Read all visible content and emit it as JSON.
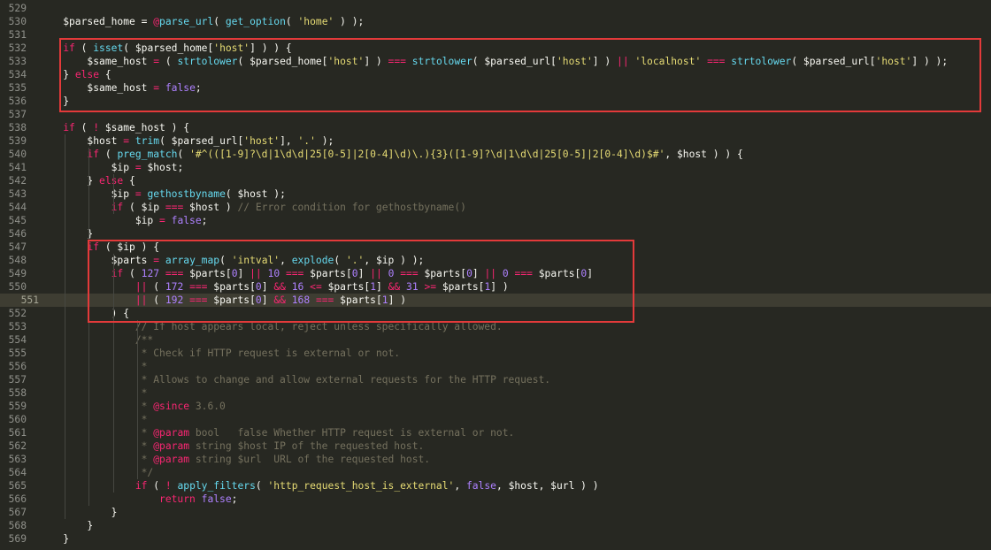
{
  "editor": {
    "theme": {
      "background": "#272822",
      "highlight_box": "#e33a3a",
      "keyword": "#f92672",
      "function": "#66d9ef",
      "string": "#e6db74",
      "number": "#ae81ff",
      "comment": "#75715e"
    },
    "active_line": 551,
    "lines": [
      {
        "n": "529",
        "t": [],
        "active": false
      },
      {
        "n": "530",
        "t": [
          [
            "v",
            "    $parsed_home = "
          ],
          [
            "k",
            "@"
          ],
          [
            "f",
            "parse_url"
          ],
          [
            "v",
            "( "
          ],
          [
            "f",
            "get_option"
          ],
          [
            "v",
            "( "
          ],
          [
            "s",
            "'home'"
          ],
          [
            "v",
            " ) );"
          ]
        ]
      },
      {
        "n": "531",
        "t": []
      },
      {
        "n": "532",
        "t": [
          [
            "v",
            "    "
          ],
          [
            "k",
            "if"
          ],
          [
            "v",
            " ( "
          ],
          [
            "f",
            "isset"
          ],
          [
            "v",
            "( $parsed_home["
          ],
          [
            "s",
            "'host'"
          ],
          [
            "v",
            "] ) ) {"
          ]
        ]
      },
      {
        "n": "533",
        "t": [
          [
            "v",
            "        $same_host "
          ],
          [
            "k",
            "="
          ],
          [
            "v",
            " ( "
          ],
          [
            "f",
            "strtolower"
          ],
          [
            "v",
            "( $parsed_home["
          ],
          [
            "s",
            "'host'"
          ],
          [
            "v",
            "] ) "
          ],
          [
            "k",
            "==="
          ],
          [
            "v",
            " "
          ],
          [
            "f",
            "strtolower"
          ],
          [
            "v",
            "( $parsed_url["
          ],
          [
            "s",
            "'host'"
          ],
          [
            "v",
            "] ) "
          ],
          [
            "k",
            "||"
          ],
          [
            "v",
            " "
          ],
          [
            "s",
            "'localhost'"
          ],
          [
            "v",
            " "
          ],
          [
            "k",
            "==="
          ],
          [
            "v",
            " "
          ],
          [
            "f",
            "strtolower"
          ],
          [
            "v",
            "( $parsed_url["
          ],
          [
            "s",
            "'host'"
          ],
          [
            "v",
            "] ) );"
          ]
        ]
      },
      {
        "n": "534",
        "t": [
          [
            "v",
            "    } "
          ],
          [
            "k",
            "else"
          ],
          [
            "v",
            " {"
          ]
        ]
      },
      {
        "n": "535",
        "t": [
          [
            "v",
            "        $same_host "
          ],
          [
            "k",
            "="
          ],
          [
            "v",
            " "
          ],
          [
            "n",
            "false"
          ],
          [
            "v",
            ";"
          ]
        ]
      },
      {
        "n": "536",
        "t": [
          [
            "v",
            "    }"
          ]
        ]
      },
      {
        "n": "537",
        "t": []
      },
      {
        "n": "538",
        "t": [
          [
            "v",
            "    "
          ],
          [
            "k",
            "if"
          ],
          [
            "v",
            " ( "
          ],
          [
            "k",
            "!"
          ],
          [
            "v",
            " $same_host ) {"
          ]
        ]
      },
      {
        "n": "539",
        "t": [
          [
            "v",
            "        $host "
          ],
          [
            "k",
            "="
          ],
          [
            "v",
            " "
          ],
          [
            "f",
            "trim"
          ],
          [
            "v",
            "( $parsed_url["
          ],
          [
            "s",
            "'host'"
          ],
          [
            "v",
            "], "
          ],
          [
            "s",
            "'.'"
          ],
          [
            "v",
            " );"
          ]
        ]
      },
      {
        "n": "540",
        "t": [
          [
            "v",
            "        "
          ],
          [
            "k",
            "if"
          ],
          [
            "v",
            " ( "
          ],
          [
            "f",
            "preg_match"
          ],
          [
            "v",
            "( "
          ],
          [
            "s",
            "'#^(([1-9]?\\d|1\\d\\d|25[0-5]|2[0-4]\\d)\\.){3}([1-9]?\\d|1\\d\\d|25[0-5]|2[0-4]\\d)$#'"
          ],
          [
            "v",
            ", $host ) ) {"
          ]
        ]
      },
      {
        "n": "541",
        "t": [
          [
            "v",
            "            $ip "
          ],
          [
            "k",
            "="
          ],
          [
            "v",
            " $host;"
          ]
        ]
      },
      {
        "n": "542",
        "t": [
          [
            "v",
            "        } "
          ],
          [
            "k",
            "else"
          ],
          [
            "v",
            " {"
          ]
        ]
      },
      {
        "n": "543",
        "t": [
          [
            "v",
            "            $ip "
          ],
          [
            "k",
            "="
          ],
          [
            "v",
            " "
          ],
          [
            "f",
            "gethostbyname"
          ],
          [
            "v",
            "( $host );"
          ]
        ]
      },
      {
        "n": "544",
        "t": [
          [
            "v",
            "            "
          ],
          [
            "k",
            "if"
          ],
          [
            "v",
            " ( $ip "
          ],
          [
            "k",
            "==="
          ],
          [
            "v",
            " $host ) "
          ],
          [
            "c",
            "// Error condition for gethostbyname()"
          ]
        ]
      },
      {
        "n": "545",
        "t": [
          [
            "v",
            "                $ip "
          ],
          [
            "k",
            "="
          ],
          [
            "v",
            " "
          ],
          [
            "n",
            "false"
          ],
          [
            "v",
            ";"
          ]
        ]
      },
      {
        "n": "546",
        "t": [
          [
            "v",
            "        }"
          ]
        ]
      },
      {
        "n": "547",
        "t": [
          [
            "v",
            "        "
          ],
          [
            "k",
            "if"
          ],
          [
            "v",
            " ( $ip ) {"
          ]
        ]
      },
      {
        "n": "548",
        "t": [
          [
            "v",
            "            $parts "
          ],
          [
            "k",
            "="
          ],
          [
            "v",
            " "
          ],
          [
            "f",
            "array_map"
          ],
          [
            "v",
            "( "
          ],
          [
            "s",
            "'intval'"
          ],
          [
            "v",
            ", "
          ],
          [
            "f",
            "explode"
          ],
          [
            "v",
            "( "
          ],
          [
            "s",
            "'.'"
          ],
          [
            "v",
            ", $ip ) );"
          ]
        ]
      },
      {
        "n": "549",
        "t": [
          [
            "v",
            "            "
          ],
          [
            "k",
            "if"
          ],
          [
            "v",
            " ( "
          ],
          [
            "n",
            "127"
          ],
          [
            "v",
            " "
          ],
          [
            "k",
            "==="
          ],
          [
            "v",
            " $parts["
          ],
          [
            "n",
            "0"
          ],
          [
            "v",
            "] "
          ],
          [
            "k",
            "||"
          ],
          [
            "v",
            " "
          ],
          [
            "n",
            "10"
          ],
          [
            "v",
            " "
          ],
          [
            "k",
            "==="
          ],
          [
            "v",
            " $parts["
          ],
          [
            "n",
            "0"
          ],
          [
            "v",
            "] "
          ],
          [
            "k",
            "||"
          ],
          [
            "v",
            " "
          ],
          [
            "n",
            "0"
          ],
          [
            "v",
            " "
          ],
          [
            "k",
            "==="
          ],
          [
            "v",
            " $parts["
          ],
          [
            "n",
            "0"
          ],
          [
            "v",
            "] "
          ],
          [
            "k",
            "||"
          ],
          [
            "v",
            " "
          ],
          [
            "n",
            "0"
          ],
          [
            "v",
            " "
          ],
          [
            "k",
            "==="
          ],
          [
            "v",
            " $parts["
          ],
          [
            "n",
            "0"
          ],
          [
            "v",
            "]"
          ]
        ]
      },
      {
        "n": "550",
        "t": [
          [
            "v",
            "                "
          ],
          [
            "k",
            "||"
          ],
          [
            "v",
            " ( "
          ],
          [
            "n",
            "172"
          ],
          [
            "v",
            " "
          ],
          [
            "k",
            "==="
          ],
          [
            "v",
            " $parts["
          ],
          [
            "n",
            "0"
          ],
          [
            "v",
            "] "
          ],
          [
            "k",
            "&&"
          ],
          [
            "v",
            " "
          ],
          [
            "n",
            "16"
          ],
          [
            "v",
            " "
          ],
          [
            "k",
            "<="
          ],
          [
            "v",
            " $parts["
          ],
          [
            "n",
            "1"
          ],
          [
            "v",
            "] "
          ],
          [
            "k",
            "&&"
          ],
          [
            "v",
            " "
          ],
          [
            "n",
            "31"
          ],
          [
            "v",
            " "
          ],
          [
            "k",
            ">="
          ],
          [
            "v",
            " $parts["
          ],
          [
            "n",
            "1"
          ],
          [
            "v",
            "] )"
          ]
        ]
      },
      {
        "n": "551",
        "t": [
          [
            "v",
            "                "
          ],
          [
            "k",
            "||"
          ],
          [
            "v",
            " ( "
          ],
          [
            "n",
            "192"
          ],
          [
            "v",
            " "
          ],
          [
            "k",
            "==="
          ],
          [
            "v",
            " $parts["
          ],
          [
            "n",
            "0"
          ],
          [
            "v",
            "] "
          ],
          [
            "k",
            "&&"
          ],
          [
            "v",
            " "
          ],
          [
            "n",
            "168"
          ],
          [
            "v",
            " "
          ],
          [
            "k",
            "==="
          ],
          [
            "v",
            " $parts["
          ],
          [
            "n",
            "1"
          ],
          [
            "v",
            "] )"
          ]
        ],
        "active": true
      },
      {
        "n": "552",
        "t": [
          [
            "v",
            "            ) {"
          ]
        ]
      },
      {
        "n": "553",
        "t": [
          [
            "v",
            "                "
          ],
          [
            "c",
            "// If host appears local, reject unless specifically allowed."
          ]
        ]
      },
      {
        "n": "554",
        "t": [
          [
            "v",
            "                "
          ],
          [
            "c",
            "/**"
          ]
        ]
      },
      {
        "n": "555",
        "t": [
          [
            "v",
            "                 "
          ],
          [
            "c",
            "* Check if HTTP request is external or not."
          ]
        ]
      },
      {
        "n": "556",
        "t": [
          [
            "v",
            "                 "
          ],
          [
            "c",
            "*"
          ]
        ]
      },
      {
        "n": "557",
        "t": [
          [
            "v",
            "                 "
          ],
          [
            "c",
            "* Allows to change and allow external requests for the HTTP request."
          ]
        ]
      },
      {
        "n": "558",
        "t": [
          [
            "v",
            "                 "
          ],
          [
            "c",
            "*"
          ]
        ]
      },
      {
        "n": "559",
        "t": [
          [
            "v",
            "                 "
          ],
          [
            "c",
            "* "
          ],
          [
            "k",
            "@since"
          ],
          [
            "c",
            " 3.6.0"
          ]
        ]
      },
      {
        "n": "560",
        "t": [
          [
            "v",
            "                 "
          ],
          [
            "c",
            "*"
          ]
        ]
      },
      {
        "n": "561",
        "t": [
          [
            "v",
            "                 "
          ],
          [
            "c",
            "* "
          ],
          [
            "k",
            "@param"
          ],
          [
            "c",
            " bool   false Whether HTTP request is external or not."
          ]
        ]
      },
      {
        "n": "562",
        "t": [
          [
            "v",
            "                 "
          ],
          [
            "c",
            "* "
          ],
          [
            "k",
            "@param"
          ],
          [
            "c",
            " string $host IP of the requested host."
          ]
        ]
      },
      {
        "n": "563",
        "t": [
          [
            "v",
            "                 "
          ],
          [
            "c",
            "* "
          ],
          [
            "k",
            "@param"
          ],
          [
            "c",
            " string $url  URL of the requested host."
          ]
        ]
      },
      {
        "n": "564",
        "t": [
          [
            "v",
            "                 "
          ],
          [
            "c",
            "*/"
          ]
        ]
      },
      {
        "n": "565",
        "t": [
          [
            "v",
            "                "
          ],
          [
            "k",
            "if"
          ],
          [
            "v",
            " ( "
          ],
          [
            "k",
            "!"
          ],
          [
            "v",
            " "
          ],
          [
            "f",
            "apply_filters"
          ],
          [
            "v",
            "( "
          ],
          [
            "s",
            "'http_request_host_is_external'"
          ],
          [
            "v",
            ", "
          ],
          [
            "n",
            "false"
          ],
          [
            "v",
            ", $host, $url ) )"
          ]
        ]
      },
      {
        "n": "566",
        "t": [
          [
            "v",
            "                    "
          ],
          [
            "k",
            "return"
          ],
          [
            "v",
            " "
          ],
          [
            "n",
            "false"
          ],
          [
            "v",
            ";"
          ]
        ]
      },
      {
        "n": "567",
        "t": [
          [
            "v",
            "            }"
          ]
        ]
      },
      {
        "n": "568",
        "t": [
          [
            "v",
            "        }"
          ]
        ]
      },
      {
        "n": "569",
        "t": [
          [
            "v",
            "    }"
          ]
        ]
      }
    ]
  }
}
